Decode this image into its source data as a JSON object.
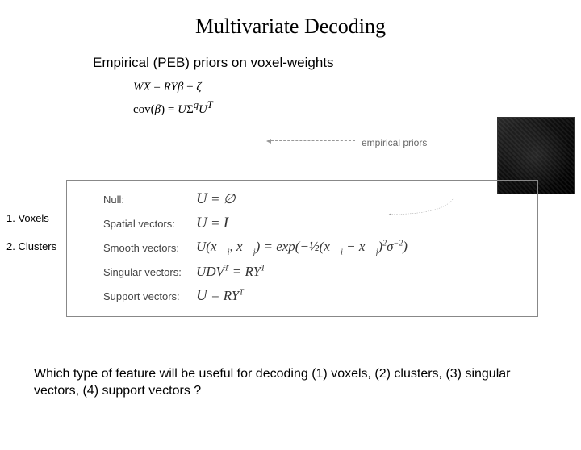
{
  "title": "Multivariate Decoding",
  "subheading": "Empirical (PEB) priors on voxel-weights",
  "eq_top1_html": "<i>WX</i> = <i>RY&beta;</i> + <i>&zeta;</i>",
  "eq_top2_html": "cov(<i>&beta;</i>) = <i>U</i>&Sigma;<sup><i>q</i></sup><i>U</i><sup><i>T</i></sup>",
  "priors_label": "empirical priors",
  "side1": "1. Voxels",
  "side2": "2. Clusters",
  "rows": {
    "null": {
      "label": "Null:",
      "eq_html": "<span class='big'><i>U</i></span> = &empty;"
    },
    "spatial": {
      "label": "Spatial vectors:",
      "eq_html": "<span class='big'><i>U</i></span> = <span class='big'><i>I</i></span>"
    },
    "smooth": {
      "label": "Smooth vectors:",
      "eq_html": "<i>U</i>(<i>x&#8407;</i><sub>i</sub>, <i>x&#8407;</i><sub>j</sub>) = exp(&minus;&frac12;(<i>x&#8407;</i><sub>i</sub> &minus; <i>x&#8407;</i><sub>j</sub>)<sup>2</sup>&sigma;<sup>&minus;2</sup>)"
    },
    "svd": {
      "label": "Singular vectors:",
      "eq_html": "<i>UDV</i><sup><i>T</i></sup> = <i>RY</i><sup><i>T</i></sup>"
    },
    "support": {
      "label": "Support vectors:",
      "eq_html": "<span class='big'><i>U</i></span> = <i>RY</i><sup><i>T</i></sup>"
    }
  },
  "matrix_name": "covariance-matrix-thumbnail",
  "question": "Which type of feature will be useful for decoding (1) voxels, (2) clusters, (3) singular vectors, (4) support vectors ?"
}
